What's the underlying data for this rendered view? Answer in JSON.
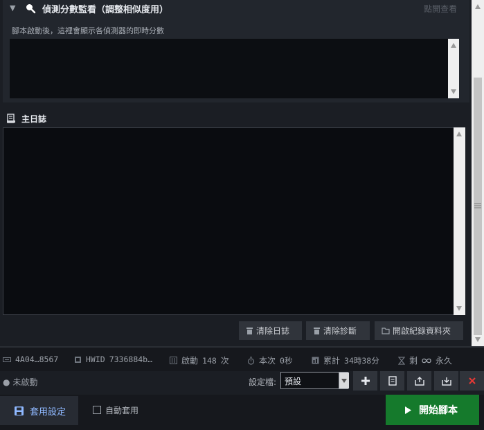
{
  "monitor": {
    "title": "偵測分數監看（調整相似度用）",
    "click_to_view": "點開查看",
    "description": "腳本啟動後，這裡會顯示各偵測器的即時分數"
  },
  "log": {
    "title": "主日誌",
    "clear_log": "清除日誌",
    "clear_diag": "清除診斷",
    "open_folder": "開啟紀錄資料夾"
  },
  "status": {
    "device_id": "4A04…8567",
    "hwid_label": "HWID",
    "hwid_value": "7336884b…",
    "launch_label": "啟動",
    "launch_count": "148",
    "launch_unit": "次",
    "session_label": "本次",
    "session_value": "0秒",
    "total_label": "累計",
    "total_value": "34時38分",
    "remaining_label": "剩",
    "remaining_value": "永久",
    "run_state": "未啟動"
  },
  "profile": {
    "label": "設定檔:",
    "selected": "預設"
  },
  "actions": {
    "apply": "套用設定",
    "auto_apply": "自動套用",
    "start": "開始腳本"
  },
  "colors": {
    "start_button": "#157a2c",
    "apply_text": "#8fb8ff",
    "delete_icon": "#e53935"
  }
}
